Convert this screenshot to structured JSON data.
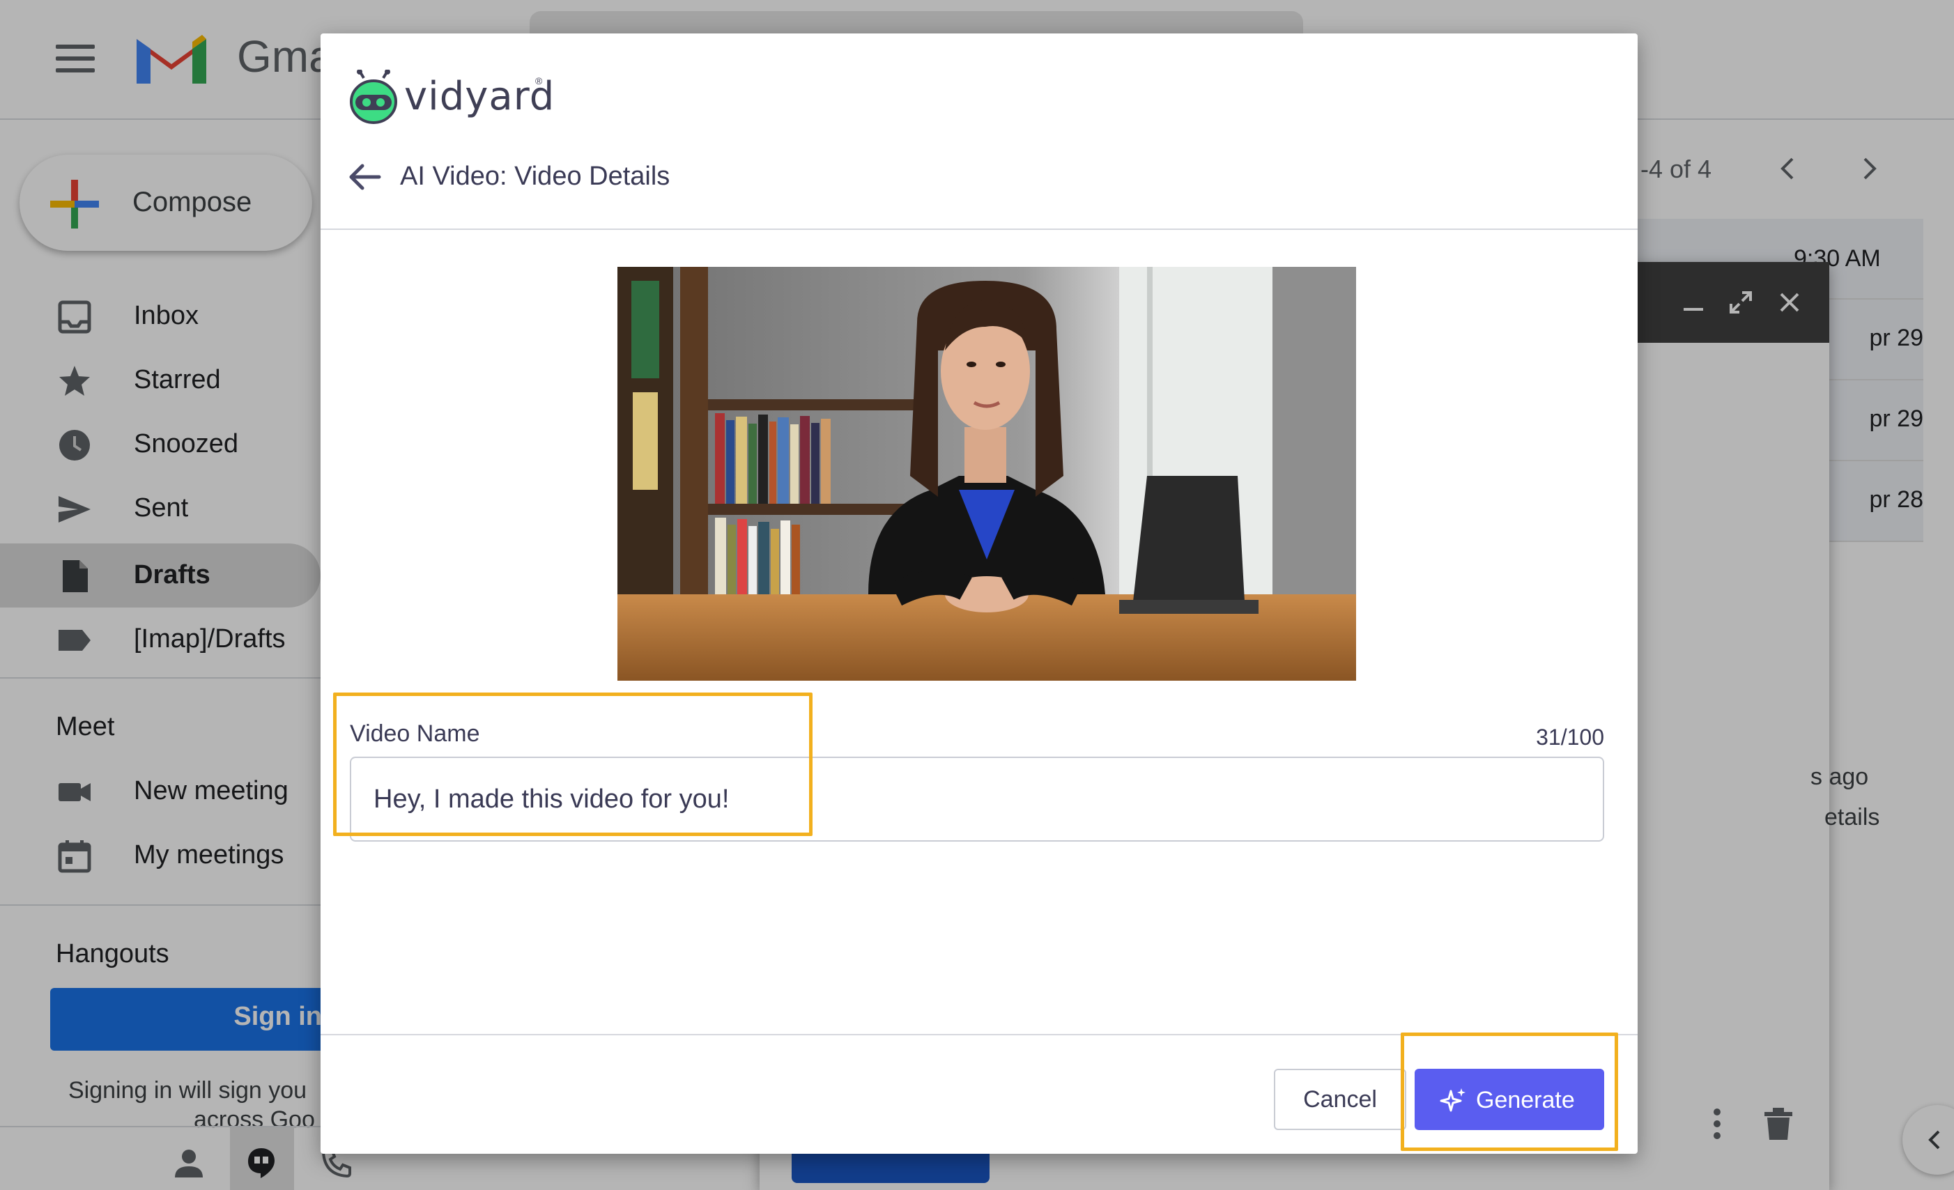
{
  "gmail": {
    "logo_text": "Gma",
    "compose_label": "Compose",
    "nav_items": [
      {
        "label": "Inbox",
        "icon": "inbox-icon"
      },
      {
        "label": "Starred",
        "icon": "star-icon"
      },
      {
        "label": "Snoozed",
        "icon": "clock-icon"
      },
      {
        "label": "Sent",
        "icon": "send-icon"
      },
      {
        "label": "Drafts",
        "icon": "draft-icon",
        "active": true
      },
      {
        "label": "[Imap]/Drafts",
        "icon": "label-icon"
      }
    ],
    "meet": {
      "title": "Meet",
      "items": [
        {
          "label": "New meeting",
          "icon": "video-camera-icon"
        },
        {
          "label": "My meetings",
          "icon": "calendar-icon"
        }
      ]
    },
    "hangouts": {
      "title": "Hangouts",
      "sign_in_label": "Sign in",
      "note_line1": "Signing in will sign you",
      "note_line2": "across Goo"
    },
    "pager": {
      "text": "-4 of 4"
    },
    "mail_times": [
      "9:30 AM",
      "pr 29",
      "pr 29",
      "pr 28"
    ],
    "side_texts": [
      "s ago",
      "etails"
    ]
  },
  "modal": {
    "brand": "vidyard",
    "brand_mark": "®",
    "title": "AI Video: Video Details",
    "video_name": {
      "label": "Video Name",
      "value": "Hey, I made this video for you!",
      "char_count": "31/100"
    },
    "cancel_label": "Cancel",
    "generate_label": "Generate",
    "colors": {
      "accent": "#5a5df0",
      "highlight": "#f2b01e",
      "brand_green": "#3ddc84"
    }
  }
}
